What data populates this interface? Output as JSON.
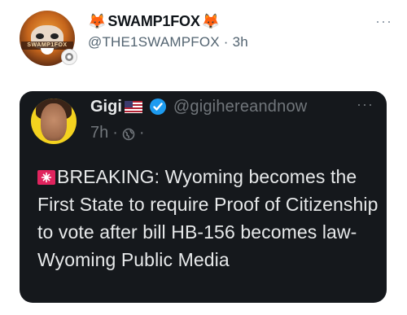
{
  "outer": {
    "emoji_left": "🦊",
    "name": "SWAMP1FOX",
    "emoji_right": "🦊",
    "handle": "@THE1SWAMPFOX",
    "separator": "·",
    "time": "3h",
    "more": "···",
    "avatar_band_text": "SWAMP1FOX"
  },
  "quote": {
    "name": "Gigi",
    "flag_icon": "us-flag-icon",
    "verified_icon": "verified-badge-icon",
    "handle": "@gigihereandnow",
    "time": "7h",
    "separator": "·",
    "separator2": "·",
    "globe_icon": "globe-icon",
    "more": "···",
    "text": "BREAKING: Wyoming becomes the First State to require Proof of Citizenship to vote after bill HB-156 becomes law- Wyoming Public Media"
  },
  "colors": {
    "card_bg": "#15181c",
    "text_light": "#e7e9ea",
    "muted": "#71767b",
    "verified_blue": "#1d9bf0",
    "avatar_ring": "#f4d21f"
  }
}
